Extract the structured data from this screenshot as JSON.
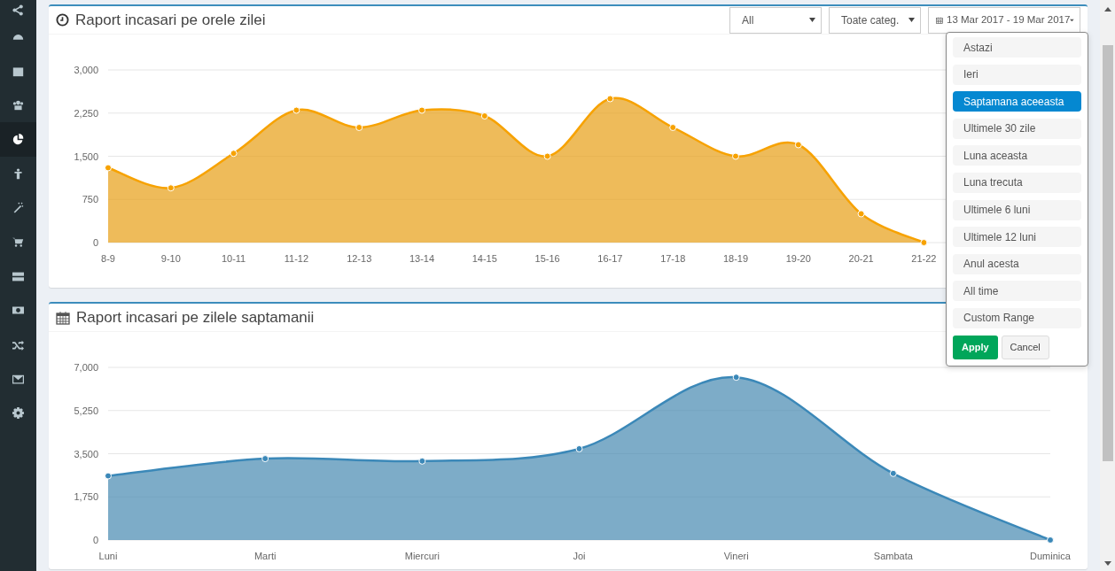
{
  "sidebar": {
    "items": [
      {
        "selected": false
      },
      {
        "selected": false
      },
      {
        "selected": false
      },
      {
        "selected": false
      },
      {
        "selected": true
      },
      {
        "selected": false
      },
      {
        "selected": false
      },
      {
        "selected": false
      },
      {
        "selected": false
      },
      {
        "selected": false
      },
      {
        "selected": false
      },
      {
        "selected": false
      },
      {
        "selected": false
      }
    ]
  },
  "hourly_report": {
    "title": "Raport incasari pe orele zilei",
    "filters": {
      "store_select": "All",
      "category_select": "Toate categ.",
      "date_range": "13 Mar 2017 - 19 Mar 2017"
    },
    "chart_data": {
      "type": "area",
      "categories": [
        "8-9",
        "9-10",
        "10-11",
        "11-12",
        "12-13",
        "13-14",
        "14-15",
        "15-16",
        "16-17",
        "17-18",
        "18-19",
        "19-20",
        "20-21",
        "21-22"
      ],
      "series": [
        {
          "color": "#f7a200",
          "values": [
            1300,
            950,
            1550,
            2300,
            2000,
            2300,
            2200,
            1500,
            2500,
            2000,
            1500,
            1700,
            500,
            0
          ]
        }
      ],
      "ylim": [
        0,
        3000
      ],
      "grid": true,
      "yticks": [
        {
          "value": 0,
          "label": "0"
        },
        {
          "value": 750,
          "label": "750"
        },
        {
          "value": 1500,
          "label": "1,500"
        },
        {
          "value": 2250,
          "label": "2,250"
        },
        {
          "value": 3000,
          "label": "3,000"
        }
      ]
    }
  },
  "date_range_menu": {
    "ranges": [
      {
        "label": "Astazi",
        "selected": false
      },
      {
        "label": "Ieri",
        "selected": false
      },
      {
        "label": "Saptamana aceeasta",
        "selected": true
      },
      {
        "label": "Ultimele 30 zile",
        "selected": false
      },
      {
        "label": "Luna aceasta",
        "selected": false
      },
      {
        "label": "Luna trecuta",
        "selected": false
      },
      {
        "label": "Ultimele 6 luni",
        "selected": false
      },
      {
        "label": "Ultimele 12 luni",
        "selected": false
      },
      {
        "label": "Anul acesta",
        "selected": false
      },
      {
        "label": "All time",
        "selected": false
      },
      {
        "label": "Custom Range",
        "selected": false
      }
    ],
    "apply": "Apply",
    "cancel": "Cancel"
  },
  "weekday_report": {
    "title": "Raport incasari pe zilele saptamanii",
    "chart_data": {
      "type": "area",
      "categories": [
        "Luni",
        "Marti",
        "Miercuri",
        "Joi",
        "Vineri",
        "Sambata",
        "Duminica"
      ],
      "series": [
        {
          "color": "#3b88b8",
          "values": [
            2600,
            3300,
            3200,
            3700,
            6600,
            2700,
            0
          ]
        }
      ],
      "ylim": [
        0,
        7000
      ],
      "grid": true,
      "yticks": [
        {
          "value": 0,
          "label": "0"
        },
        {
          "value": 1750,
          "label": "1,750"
        },
        {
          "value": 3500,
          "label": "3,500"
        },
        {
          "value": 5250,
          "label": "5,250"
        },
        {
          "value": 7000,
          "label": "7,000"
        }
      ]
    }
  }
}
